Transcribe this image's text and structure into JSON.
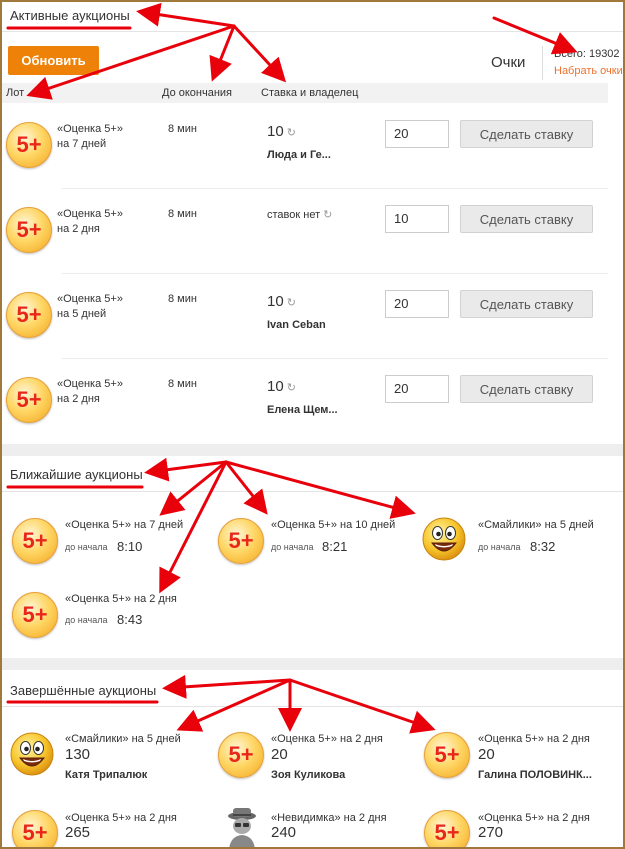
{
  "active": {
    "title": "Активные аукционы",
    "refresh_button": "Обновить",
    "points_label": "Очки",
    "total": "Всего: 19302",
    "earn_link": "Набрать очки",
    "columns": [
      "Лот",
      "До окончания",
      "Ставка и владелец"
    ],
    "rows": [
      {
        "name": "«Оценка 5+»",
        "duration": "на 7 дней",
        "time": "8 мин",
        "bid": "10",
        "owner": "Люда и Ге...",
        "input": "20",
        "button": "Сделать ставку"
      },
      {
        "name": "«Оценка 5+»",
        "duration": "на 2 дня",
        "time": "8 мин",
        "bid": "ставок нет",
        "owner": "",
        "input": "10",
        "button": "Сделать ставку"
      },
      {
        "name": "«Оценка 5+»",
        "duration": "на 5 дней",
        "time": "8 мин",
        "bid": "10",
        "owner": "Ivan Ceban",
        "input": "20",
        "button": "Сделать ставку"
      },
      {
        "name": "«Оценка 5+»",
        "duration": "на 2 дня",
        "time": "8 мин",
        "bid": "10",
        "owner": "Елена Щем...",
        "input": "20",
        "button": "Сделать ставку"
      }
    ]
  },
  "upcoming": {
    "title": "Ближайшие аукционы",
    "start_label": "до начала",
    "items": [
      {
        "name": "«Оценка 5+»",
        "duration": "на 7 дней",
        "time": "8:10",
        "icon": "five-plus-icon"
      },
      {
        "name": "«Оценка 5+»",
        "duration": "на 10 дней",
        "time": "8:21",
        "icon": "five-plus-icon"
      },
      {
        "name": "«Смайлики»",
        "duration": "на 5 дней",
        "time": "8:32",
        "icon": "smiley-icon"
      },
      {
        "name": "«Оценка 5+»",
        "duration": "на 2 дня",
        "time": "8:43",
        "icon": "five-plus-icon"
      }
    ]
  },
  "finished": {
    "title": "Завершённые аукционы",
    "items": [
      {
        "name": "«Смайлики»",
        "duration": "на 5 дней",
        "value": "130",
        "owner": "Катя Трипалюк",
        "icon": "smiley-icon"
      },
      {
        "name": "«Оценка 5+»",
        "duration": "на 2 дня",
        "value": "20",
        "owner": "Зоя Куликова",
        "icon": "five-plus-icon"
      },
      {
        "name": "«Оценка 5+»",
        "duration": "на 2 дня",
        "value": "20",
        "owner": "Галина ПОЛОВИНК...",
        "icon": "five-plus-icon"
      },
      {
        "name": "«Оценка 5+»",
        "duration": "на 2 дня",
        "value": "265",
        "owner": "",
        "icon": "five-plus-icon"
      },
      {
        "name": "«Невидимка»",
        "duration": "на 2 дня",
        "value": "240",
        "owner": "",
        "icon": "invisible-icon"
      },
      {
        "name": "«Оценка 5+»",
        "duration": "на 2 дня",
        "value": "270",
        "owner": "",
        "icon": "five-plus-icon"
      }
    ]
  },
  "badge_text": "5+",
  "colors": {
    "accent": "#ee8208",
    "link": "#eb722e",
    "annotation": "#e8000b",
    "frame": "#a0783c"
  }
}
